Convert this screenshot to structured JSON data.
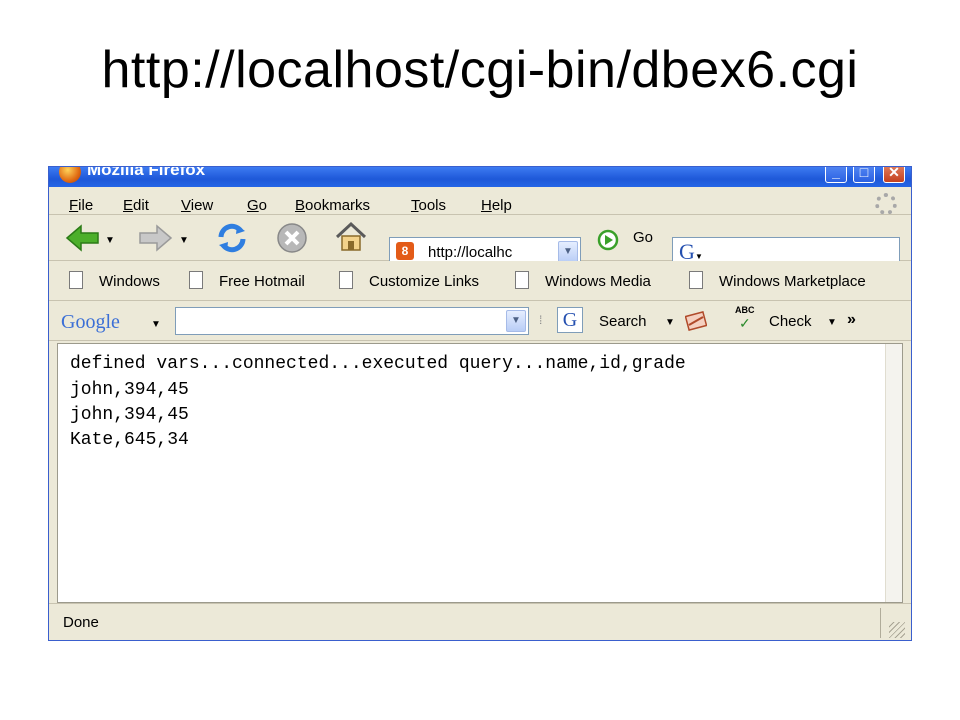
{
  "slide": {
    "title": "http://localhost/cgi-bin/dbex6.cgi"
  },
  "window": {
    "title": "Mozilla Firefox",
    "min": "_",
    "max": "□",
    "close": "✕"
  },
  "menu": [
    "File",
    "Edit",
    "View",
    "Go",
    "Bookmarks",
    "Tools",
    "Help"
  ],
  "navbar": {
    "url": "http://localhc",
    "favicon": "8",
    "go_label": "Go",
    "search_logo": "G"
  },
  "bookmarks": [
    "Windows",
    "Free Hotmail",
    "Customize Links",
    "Windows Media",
    "Windows Marketplace"
  ],
  "google_toolbar": {
    "logo": "Google",
    "search_label": "Search",
    "check_label": "Check",
    "more": "»",
    "g_icon": "G",
    "abc": "ABC"
  },
  "content": {
    "lines": [
      "defined vars...connected...executed query...name,id,grade",
      "john,394,45",
      "john,394,45",
      "Kate,645,34"
    ]
  },
  "status": {
    "text": "Done"
  },
  "icons": {
    "back": "back-arrow-icon",
    "forward": "forward-arrow-icon",
    "reload": "reload-icon",
    "stop": "stop-icon",
    "home": "home-icon",
    "go": "go-icon"
  },
  "colors": {
    "titlebar": "#2465e6",
    "chrome": "#ece9d8",
    "back_arrow": "#4caf2a"
  }
}
